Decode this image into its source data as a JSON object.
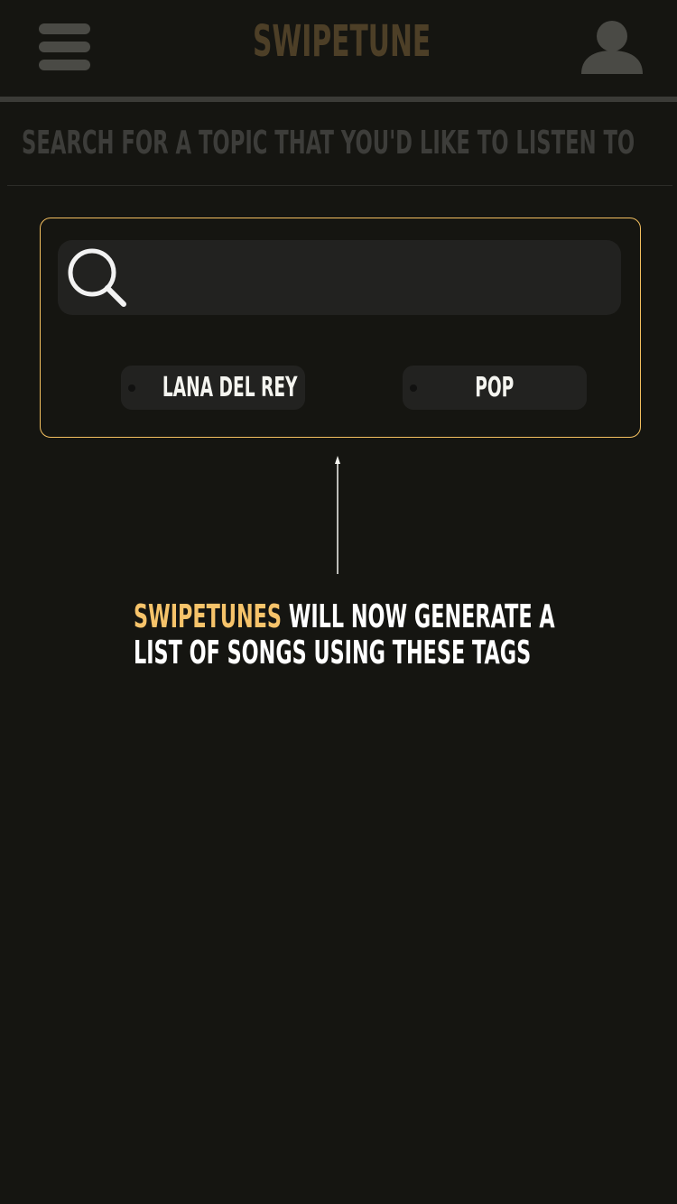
{
  "header": {
    "title": "SWIPETUNE",
    "menu_icon": "hamburger-menu-icon",
    "profile_icon": "user-profile-icon"
  },
  "prompt": {
    "text": "SEARCH FOR A TOPIC THAT YOU'D LIKE TO LISTEN TO"
  },
  "search": {
    "icon": "search-icon",
    "value": ""
  },
  "tags": [
    {
      "label": "LANA DEL REY"
    },
    {
      "label": "POP"
    }
  ],
  "annotation": {
    "highlight": "SWIPETUNES",
    "line1_rest": " WILL NOW GENERATE A",
    "line2": "LIST OF SONGS USING THESE TAGS"
  },
  "colors": {
    "background": "#151511",
    "accent": "#f6c36a",
    "brand": "#4d3f27",
    "card_border": "#f4c060"
  }
}
